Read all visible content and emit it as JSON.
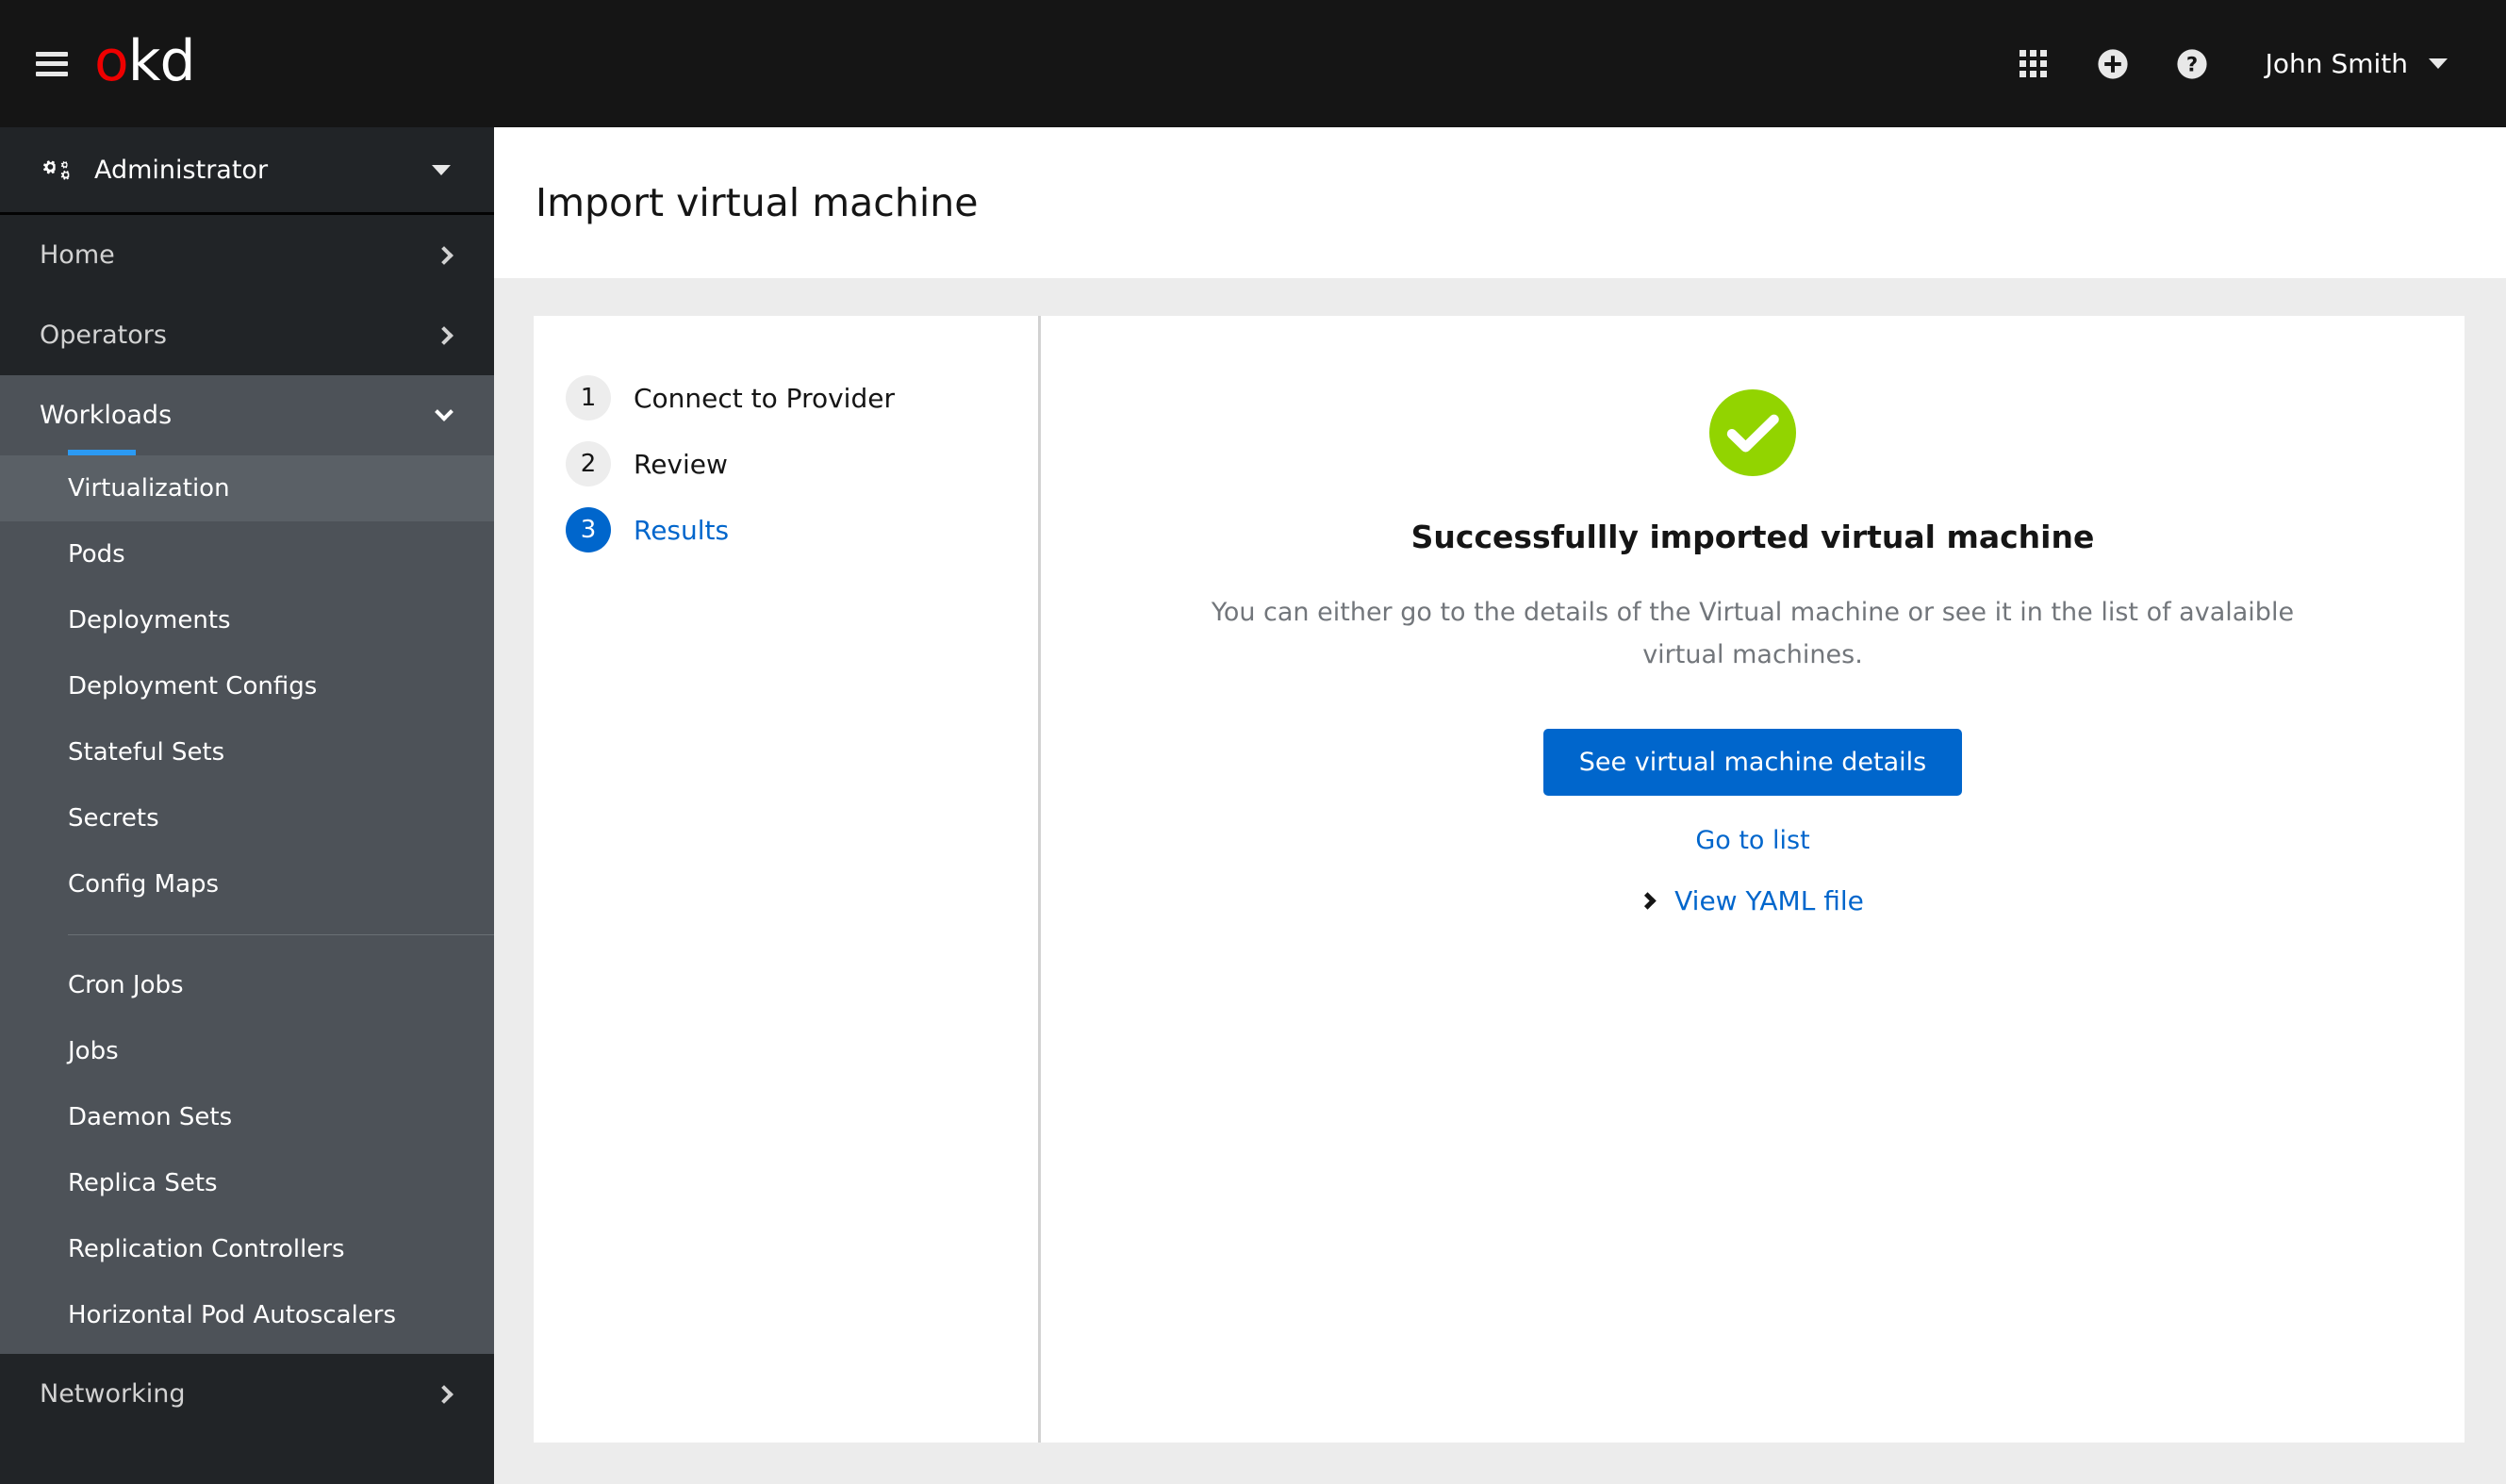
{
  "masthead": {
    "menu_icon": "hamburger-icon",
    "logo_first": "o",
    "logo_rest": "kd",
    "apps_icon": "grid-icon",
    "add_icon": "plus-circle-icon",
    "help_icon": "question-circle-icon",
    "user_name": "John Smith",
    "user_caret": "caret-down-icon"
  },
  "sidebar": {
    "perspective": {
      "icon": "cogs-icon",
      "label": "Administrator",
      "caret": "caret-down-icon"
    },
    "groups": [
      {
        "label": "Home",
        "expanded": false,
        "chevron": "chevron-right-icon"
      },
      {
        "label": "Operators",
        "expanded": false,
        "chevron": "chevron-right-icon"
      },
      {
        "label": "Workloads",
        "expanded": true,
        "chevron": "chevron-down-icon"
      },
      {
        "label": "Networking",
        "expanded": false,
        "chevron": "chevron-right-icon"
      }
    ],
    "workloads_items": [
      {
        "label": "Virtualization",
        "active": true
      },
      {
        "label": "Pods",
        "active": false
      },
      {
        "label": "Deployments",
        "active": false
      },
      {
        "label": "Deployment Configs",
        "active": false
      },
      {
        "label": "Stateful Sets",
        "active": false
      },
      {
        "label": "Secrets",
        "active": false
      },
      {
        "label": "Config Maps",
        "active": false
      },
      {
        "label": "Cron Jobs",
        "active": false
      },
      {
        "label": "Jobs",
        "active": false
      },
      {
        "label": "Daemon Sets",
        "active": false
      },
      {
        "label": "Replica Sets",
        "active": false
      },
      {
        "label": "Replication Controllers",
        "active": false
      },
      {
        "label": "Horizontal Pod Autoscalers",
        "active": false
      }
    ]
  },
  "page": {
    "title": "Import virtual machine"
  },
  "wizard": {
    "steps": [
      {
        "number": "1",
        "label": "Connect to Provider",
        "current": false
      },
      {
        "number": "2",
        "label": "Review",
        "current": false
      },
      {
        "number": "3",
        "label": "Results",
        "current": true
      }
    ],
    "result": {
      "status_icon": "check-circle-icon",
      "heading": "Successfullly imported virtual machine",
      "description": "You can either go to the details of the Virtual machine or see it in the list of avalaible virtual machines.",
      "primary_button": "See virtual machine details",
      "secondary_link": "Go to list",
      "yaml_toggle_icon": "chevron-right-icon",
      "yaml_toggle_label": "View YAML file"
    }
  },
  "colors": {
    "masthead_bg": "#151515",
    "sidebar_bg": "#212427",
    "sidebar_expanded_bg": "#4d5258",
    "sidebar_active_bg": "#5a6066",
    "accent_blue": "#0066cc",
    "active_bar_blue": "#2b9af3",
    "success_green": "#92d400",
    "content_bg": "#ececec",
    "logo_red": "#ee0000"
  }
}
